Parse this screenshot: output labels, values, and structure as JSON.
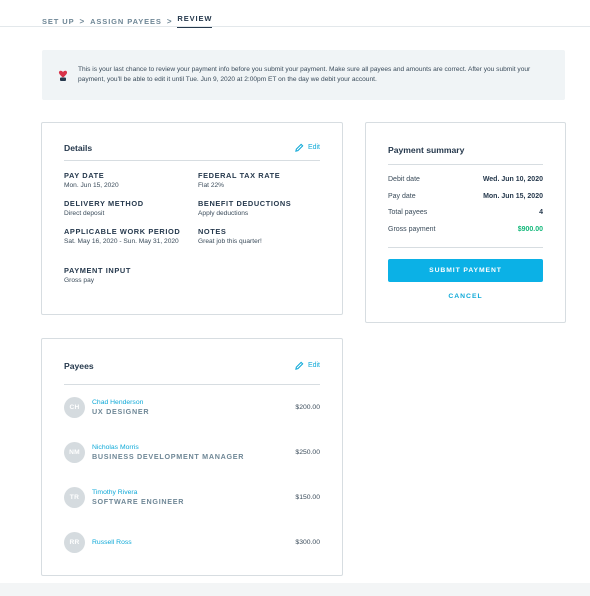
{
  "breadcrumb": {
    "step1": "SET UP",
    "step2": "ASSIGN PAYEES",
    "step3": "REVIEW",
    "separator": ">"
  },
  "notice": {
    "text": "This is your last chance to review your payment info before you submit your payment. Make sure all payees and amounts are correct. After you submit your payment, you'll be able to edit it until Tue. Jun 9, 2020 at 2:00pm ET on the day we debit your account.",
    "icon": "heart-hand-icon"
  },
  "details": {
    "title": "Details",
    "edit_label": "Edit",
    "pay_date": {
      "label": "PAY DATE",
      "value": "Mon. Jun 15, 2020"
    },
    "federal_tax_rate": {
      "label": "FEDERAL TAX RATE",
      "value": "Flat 22%"
    },
    "delivery_method": {
      "label": "DELIVERY METHOD",
      "value": "Direct deposit"
    },
    "benefit_deductions": {
      "label": "BENEFIT DEDUCTIONS",
      "value": "Apply deductions"
    },
    "work_period": {
      "label": "APPLICABLE WORK PERIOD",
      "value": "Sat. May 16, 2020 - Sun. May 31, 2020"
    },
    "notes": {
      "label": "NOTES",
      "value": "Great job this quarter!"
    },
    "payment_input": {
      "label": "PAYMENT INPUT",
      "value": "Gross pay"
    }
  },
  "summary": {
    "title": "Payment summary",
    "debit_date": {
      "label": "Debit date",
      "value": "Wed. Jun 10, 2020"
    },
    "pay_date": {
      "label": "Pay date",
      "value": "Mon. Jun 15, 2020"
    },
    "total_payees": {
      "label": "Total payees",
      "value": "4"
    },
    "gross_payment": {
      "label": "Gross payment",
      "value": "$900.00"
    },
    "submit_label": "SUBMIT PAYMENT",
    "cancel_label": "CANCEL"
  },
  "payees": {
    "title": "Payees",
    "edit_label": "Edit",
    "items": [
      {
        "initials": "CH",
        "name": "Chad Henderson",
        "role": "UX DESIGNER",
        "amount": "$200.00"
      },
      {
        "initials": "NM",
        "name": "Nicholas Morris",
        "role": "BUSINESS DEVELOPMENT MANAGER",
        "amount": "$250.00"
      },
      {
        "initials": "TR",
        "name": "Timothy Rivera",
        "role": "SOFTWARE ENGINEER",
        "amount": "$150.00"
      },
      {
        "initials": "RR",
        "name": "Russell Ross",
        "role": "",
        "amount": "$300.00"
      }
    ]
  },
  "colors": {
    "accent": "#0bb1e6",
    "link": "#0fa9d8",
    "success": "#13b87a",
    "heading": "#26394d"
  }
}
